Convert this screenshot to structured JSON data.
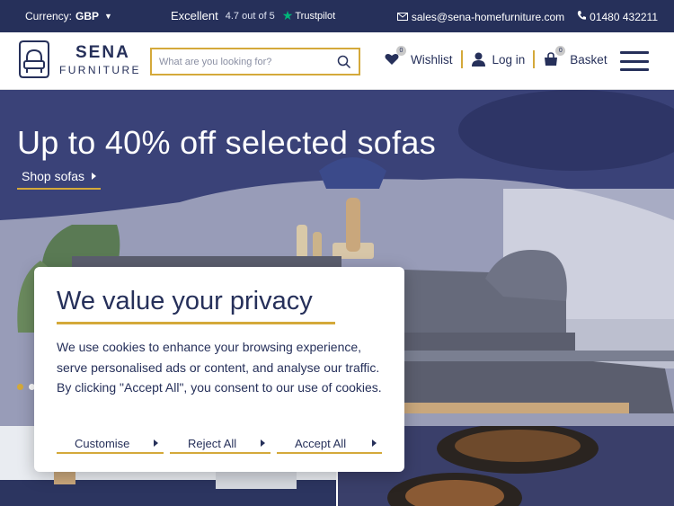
{
  "topbar": {
    "currency_label": "Currency:",
    "currency_value": "GBP",
    "trust_excellent": "Excellent",
    "trust_rating": "4.7 out of 5",
    "trust_brand": "Trustpilot",
    "email": "sales@sena-homefurniture.com",
    "phone": "01480 432211"
  },
  "header": {
    "logo_name": "SENA",
    "logo_sub": "FURNITURE",
    "search_placeholder": "What are you looking for?",
    "wishlist_label": "Wishlist",
    "wishlist_count": "0",
    "login_label": "Log in",
    "basket_label": "Basket",
    "basket_count": "0"
  },
  "hero": {
    "title": "Up to 40% off selected sofas",
    "cta": "Shop sofas",
    "slide_count": 2,
    "active_slide": 1
  },
  "cookie": {
    "title": "We value your privacy",
    "body": "We use cookies to enhance your browsing experience, serve personalised ads or content, and analyse our traffic. By clicking \"Accept All\", you consent to our use of cookies.",
    "customise": "Customise",
    "reject": "Reject All",
    "accept": "Accept All"
  },
  "colors": {
    "navy": "#26305a",
    "gold": "#d4a93a",
    "trustpilot_green": "#00b67a"
  },
  "icons": [
    "chevron-down-icon",
    "trustpilot-star-icon",
    "mail-icon",
    "phone-icon",
    "search-icon",
    "heart-icon",
    "user-icon",
    "basket-icon",
    "hamburger-menu-icon"
  ]
}
